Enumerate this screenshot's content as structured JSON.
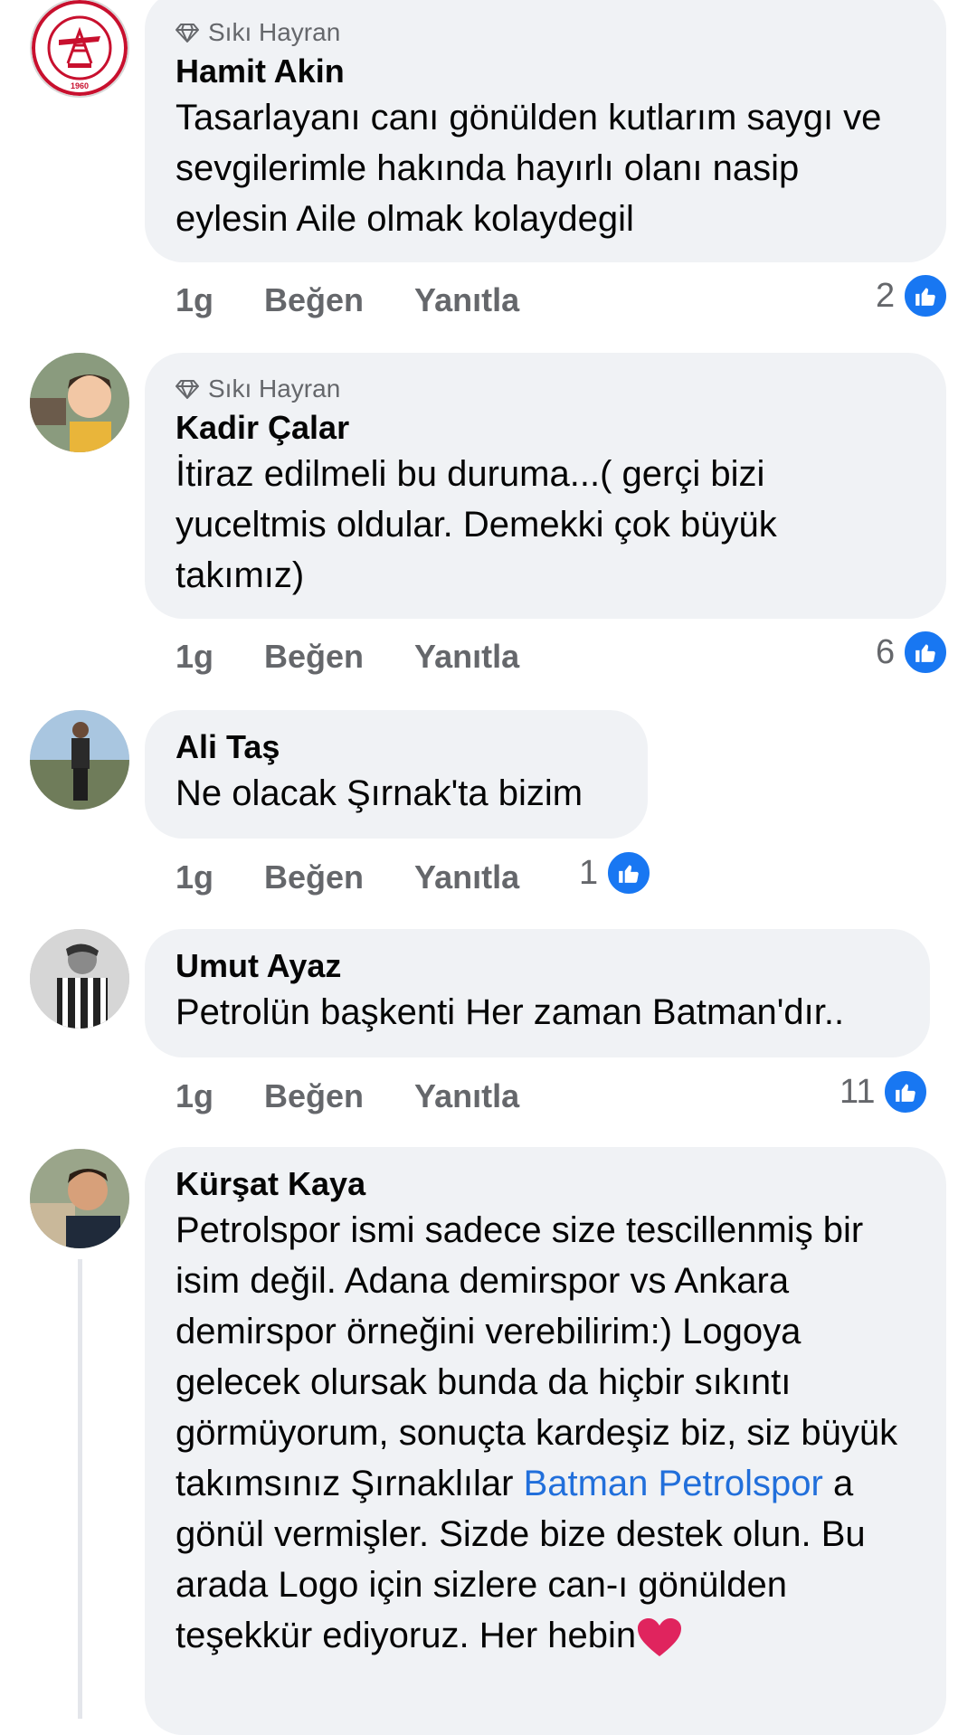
{
  "comments": [
    {
      "badge": "Sıkı Hayran",
      "author": "Hamit Akin",
      "text": "Tasarlayanı canı gönülden kutlarım saygı ve sevgilerimle hakında hayırlı olanı nasip eylesin Aile olmak kolaydegil",
      "time": "1g",
      "like_label": "Beğen",
      "reply_label": "Yanıtla",
      "reaction_count": "2",
      "avatar_logo_text": "BATMAN PETROLSPOR 1960"
    },
    {
      "badge": "Sıkı Hayran",
      "author": "Kadir Çalar",
      "text": "İtiraz edilmeli bu duruma...( gerçi bizi yuceltmis oldular. Demekki çok büyük takımız)",
      "time": "1g",
      "like_label": "Beğen",
      "reply_label": "Yanıtla",
      "reaction_count": "6"
    },
    {
      "author": "Ali Taş",
      "text": "Ne olacak Şırnak'ta bizim",
      "time": "1g",
      "like_label": "Beğen",
      "reply_label": "Yanıtla",
      "reaction_count": "1"
    },
    {
      "author": "Umut Ayaz",
      "text": "Petrolün başkenti Her zaman Batman'dır..",
      "time": "1g",
      "like_label": "Beğen",
      "reply_label": "Yanıtla",
      "reaction_count": "11"
    },
    {
      "author": "Kürşat Kaya",
      "text_before_link": "Petrolspor ismi sadece size tescillenmiş bir isim değil. Adana demirspor vs Ankara demirspor örneğini verebilirim:) Logoya gelecek olursak bunda da hiçbir sıkıntı görmüyorum, sonuçta kardeşiz biz, siz büyük takımsınız Şırnaklılar ",
      "link": "Batman Petrolspor",
      "text_after_link": " a gönül vermişler. Sizde bize destek olun. Bu arada Logo için sizlere can-ı gönülden teşekkür ediyoruz. Her hebin"
    }
  ],
  "colors": {
    "bubble": "#f0f2f5",
    "link": "#216fdb",
    "like_blue": "#1877f2",
    "muted": "#65676b",
    "heart": "#e0245e"
  },
  "icons": [
    "diamond-icon",
    "like-icon",
    "heart-icon"
  ]
}
